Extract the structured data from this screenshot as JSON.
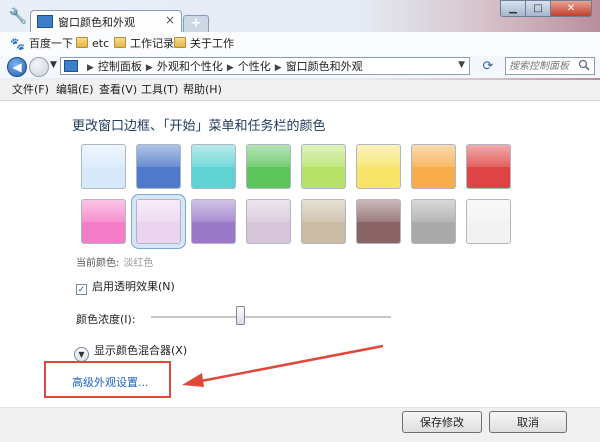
{
  "browser": {
    "tab_title": "窗口颜色和外观",
    "new_tab_label": "+",
    "bookmarks": [
      {
        "label": "百度一下",
        "icon": "paw-icon"
      },
      {
        "label": "etc",
        "icon": "folder-icon"
      },
      {
        "label": "工作记录",
        "icon": "folder-icon"
      },
      {
        "label": "关于工作",
        "icon": "folder-icon"
      }
    ],
    "breadcrumbs": [
      "控制面板",
      "外观和个性化",
      "个性化",
      "窗口颜色和外观"
    ],
    "search_placeholder": "搜索控制面板",
    "window_buttons": {
      "minimize": "▁",
      "maximize": "□",
      "close": "✕"
    }
  },
  "menubar": [
    "文件(F)",
    "编辑(E)",
    "查看(V)",
    "工具(T)",
    "帮助(H)"
  ],
  "main": {
    "heading": "更改窗口边框、「开始」菜单和任务栏的颜色",
    "swatches": [
      {
        "name": "sky",
        "color": "#d7e9fb"
      },
      {
        "name": "twilight",
        "color": "#4f7ac9"
      },
      {
        "name": "sea",
        "color": "#5fd3d3"
      },
      {
        "name": "leaf",
        "color": "#5ec45c"
      },
      {
        "name": "lime",
        "color": "#b7e36a"
      },
      {
        "name": "pumpkin-yellow",
        "color": "#f7e468"
      },
      {
        "name": "pumpkin",
        "color": "#f6ad4a"
      },
      {
        "name": "ruby",
        "color": "#df4444"
      },
      {
        "name": "fuchsia",
        "color": "#f57dc7"
      },
      {
        "name": "blush",
        "color": "#ecd4f1"
      },
      {
        "name": "violet",
        "color": "#9a7ac7"
      },
      {
        "name": "lavender",
        "color": "#d6c5d9"
      },
      {
        "name": "taupe",
        "color": "#c9bba4"
      },
      {
        "name": "chocolate",
        "color": "#8b6467"
      },
      {
        "name": "slate",
        "color": "#aaaaaa"
      },
      {
        "name": "frost",
        "color": "#f2f2f2"
      }
    ],
    "selected_index": 9,
    "current_color_label": "当前颜色:",
    "current_color_value": "淡红色",
    "transparency_label": "启用透明效果(N)",
    "transparency_checked": true,
    "intensity_label": "颜色浓度(I):",
    "intensity_value": 0.37,
    "mixer_label": "显示颜色混合器(X)",
    "advanced_link": "高级外观设置...",
    "annotation_color": "#e2473b"
  },
  "footer": {
    "save_label": "保存修改",
    "cancel_label": "取消"
  }
}
